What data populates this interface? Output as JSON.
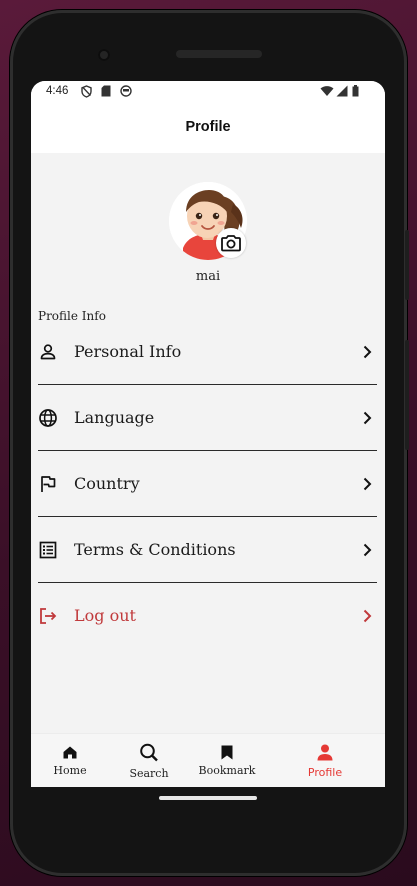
{
  "status_bar": {
    "time": "4:46",
    "left_icons": [
      "shield-icon",
      "sim-card-icon",
      "sync-icon"
    ],
    "right_icons": [
      "wifi-icon",
      "signal-icon",
      "battery-icon"
    ]
  },
  "app_bar": {
    "title": "Profile"
  },
  "profile": {
    "username": "mai",
    "camera_icon": "camera-icon"
  },
  "section": {
    "label": "Profile Info"
  },
  "menu": {
    "items": [
      {
        "label": "Personal Info",
        "icon": "person-icon"
      },
      {
        "label": "Language",
        "icon": "globe-icon"
      },
      {
        "label": "Country",
        "icon": "flag-icon"
      },
      {
        "label": "Terms & Conditions",
        "icon": "list-icon"
      },
      {
        "label": "Log out",
        "icon": "logout-icon"
      }
    ]
  },
  "bottom_nav": {
    "items": [
      {
        "label": "Home",
        "icon": "home-icon"
      },
      {
        "label": "Search",
        "icon": "search-icon"
      },
      {
        "label": "Bookmark",
        "icon": "bookmark-icon"
      },
      {
        "label": "Profile",
        "icon": "person-icon"
      }
    ],
    "active_index": 3
  },
  "colors": {
    "accent": "#e53935",
    "logout": "#c0393b",
    "background": "#f3f3f3",
    "app_bar": "#ffffff"
  }
}
